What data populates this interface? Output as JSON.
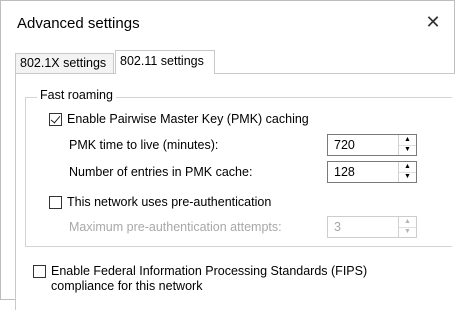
{
  "window": {
    "title": "Advanced settings",
    "close_glyph": "✕"
  },
  "tabs": [
    {
      "label": "802.1X settings",
      "selected": false
    },
    {
      "label": "802.11 settings",
      "selected": true
    }
  ],
  "fast_roaming": {
    "group_label": "Fast roaming",
    "pmk_caching": {
      "label": "Enable Pairwise Master Key (PMK) caching",
      "checked": true
    },
    "pmk_ttl": {
      "label": "PMK time to live (minutes):",
      "value": "720"
    },
    "pmk_entries": {
      "label": "Number of entries in PMK cache:",
      "value": "128"
    },
    "preauth": {
      "label": "This network uses pre-authentication",
      "checked": false
    },
    "preauth_attempts": {
      "label": "Maximum pre-authentication attempts:",
      "value": "3",
      "enabled": false
    }
  },
  "fips": {
    "label_line1": "Enable Federal Information Processing Standards (FIPS)",
    "label_line2": "compliance for this network",
    "checked": false
  },
  "spin_glyphs": {
    "up": "▲",
    "down": "▼"
  }
}
